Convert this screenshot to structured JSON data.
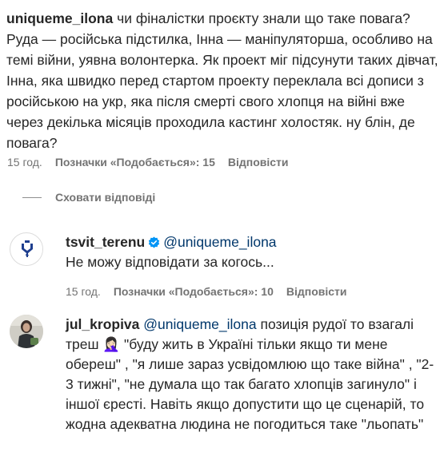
{
  "comment_main": {
    "username": "uniqueme_ilona",
    "text": " чи фіналістки проєкту знали що таке повага? Руда — російська підстилка, Інна — маніпуляторша, особливо на темі війни, уявна волонтерка. Як проект міг підсунути таких дівчат, Інна, яка швидко перед стартом проекту переклала всі дописи з російською на укр, яка після смерті свого хлопця на війні вже через декілька місяців проходила кастинг холостяк. ну блін, де повага?",
    "time": "15 год.",
    "likes": "Позначки «Подобається»: 15",
    "reply_label": "Відповісти"
  },
  "hide_replies": {
    "label": "Сховати відповіді"
  },
  "replies": [
    {
      "username": "tsvit_terenu",
      "verified": true,
      "mention": "@uniqueme_ilona",
      "text": "Не можу відповідати за когось...",
      "time": "15 год.",
      "likes": "Позначки «Подобається»: 10",
      "reply_label": "Відповісти"
    },
    {
      "username": "jul_kropiva",
      "verified": false,
      "mention": "@uniqueme_ilona",
      "text_part1": " позиція рудої то взагалі треш ",
      "emoji": "🤦🏻‍♀️",
      "text_part2": " \"буду жить в Україні тільки якщо ти мене обереш\" , \"я лише зараз усвідомлюю що таке війна\" , \"2-3 тижні\", \"не думала що так багато хлопців загинуло\" і іншої єресті. Навіть якщо допустити що це сценарій, то жодна адекватна людина не погодиться таке \"льопать\""
    }
  ],
  "colors": {
    "text": "#262626",
    "secondary": "#737373",
    "mention": "#00376b",
    "verified": "#0095f6"
  }
}
